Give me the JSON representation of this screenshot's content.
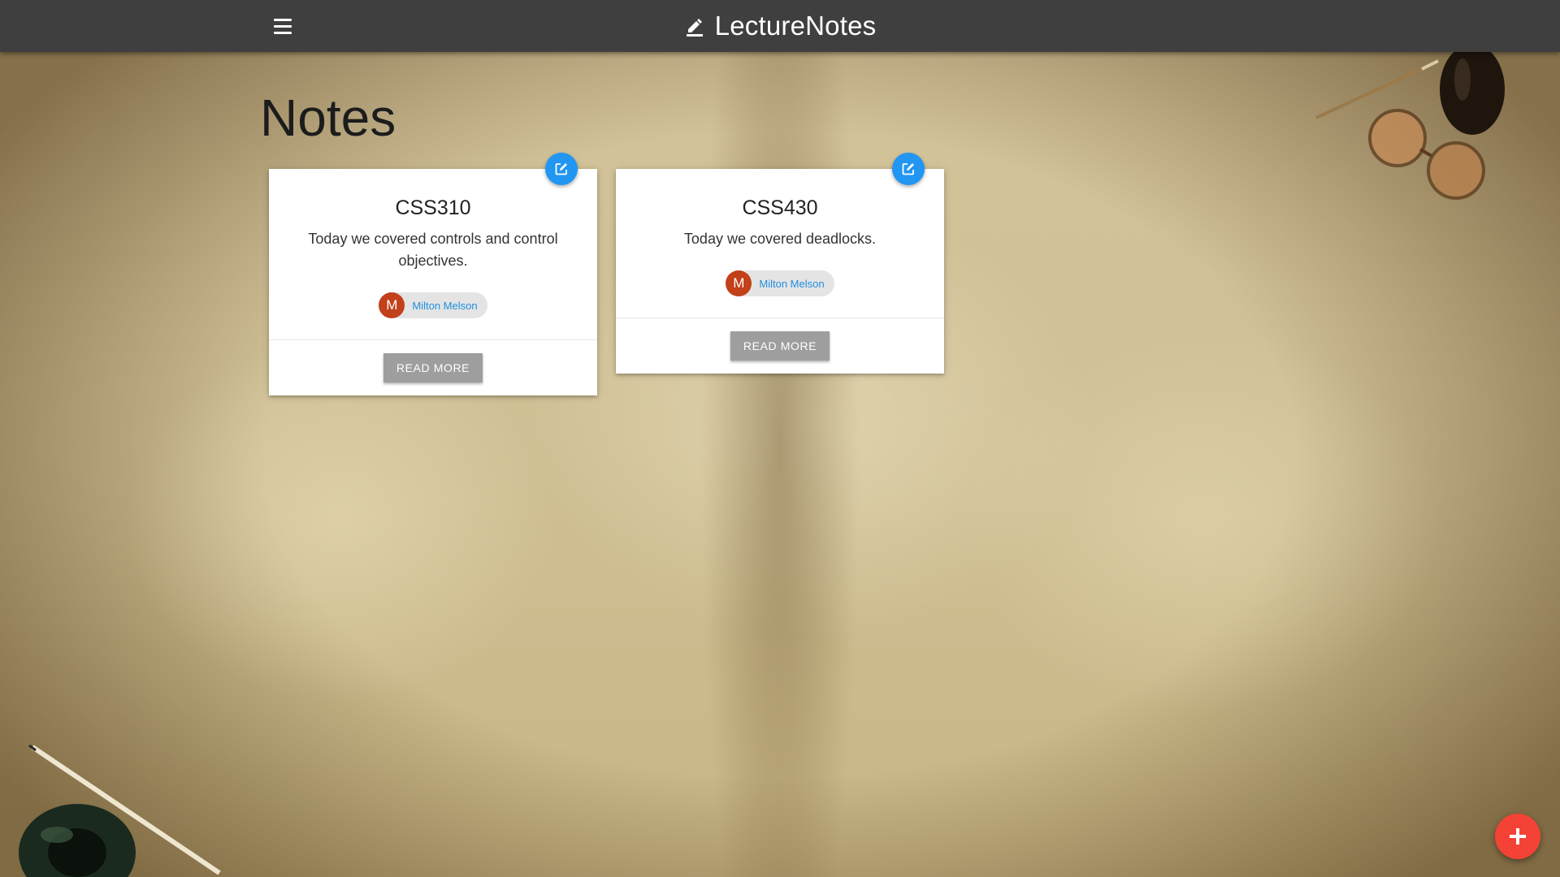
{
  "app": {
    "title": "LectureNotes",
    "menu_icon": "hamburger-menu-icon",
    "brand_icon": "pencil-icon"
  },
  "page": {
    "heading": "Notes"
  },
  "notes": [
    {
      "title": "CSS310",
      "body": "Today we covered controls and control objectives.",
      "author_initial": "M",
      "author_name": "Milton Melson",
      "action_label": "READ MORE"
    },
    {
      "title": "CSS430",
      "body": "Today we covered deadlocks.",
      "author_initial": "M",
      "author_name": "Milton Melson",
      "action_label": "READ MORE"
    }
  ],
  "colors": {
    "appbar": "#3f3f3f",
    "edit_fab": "#2196f3",
    "add_fab": "#f44336",
    "avatar": "#c2401a",
    "author_link": "#1f8fe0",
    "button": "#9e9e9e"
  },
  "icons": {
    "edit": "edit-icon",
    "add": "plus-icon"
  }
}
